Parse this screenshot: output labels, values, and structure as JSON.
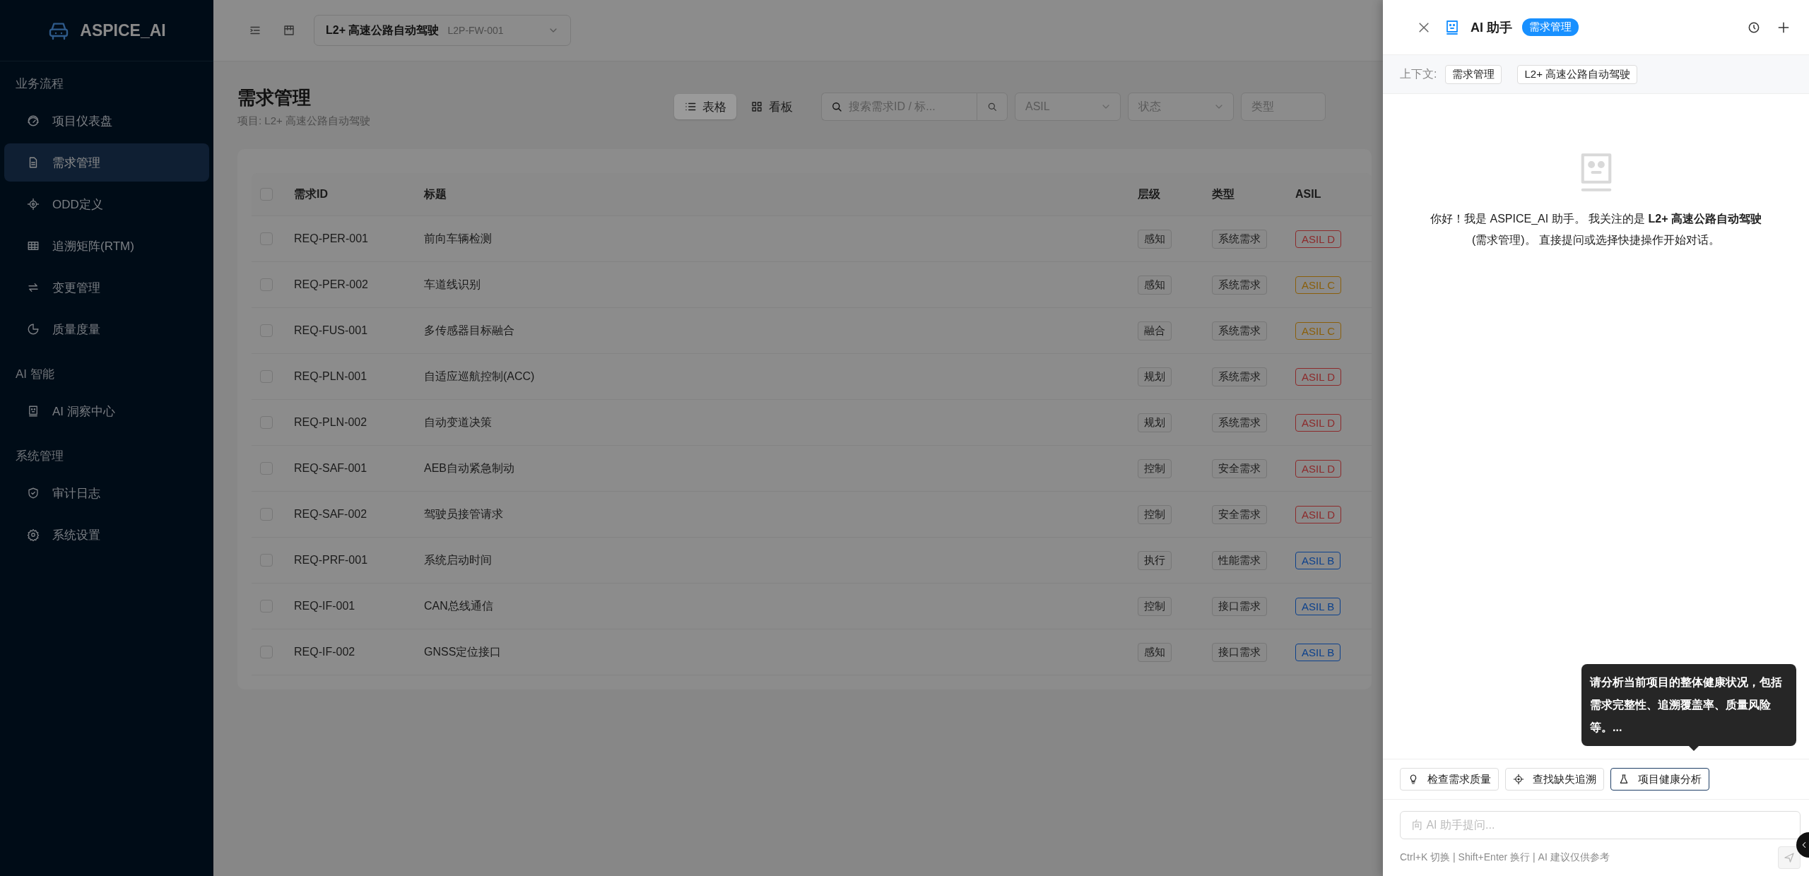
{
  "sidebar": {
    "logo": "ASPICE_AI",
    "sections": [
      {
        "title": "业务流程",
        "items": [
          {
            "label": "项目仪表盘",
            "selected": false
          },
          {
            "label": "需求管理",
            "selected": true
          },
          {
            "label": "ODD定义",
            "selected": false
          },
          {
            "label": "追溯矩阵(RTM)",
            "selected": false
          },
          {
            "label": "变更管理",
            "selected": false
          },
          {
            "label": "质量度量",
            "selected": false
          }
        ]
      },
      {
        "title": "AI 智能",
        "items": [
          {
            "label": "AI 洞察中心",
            "selected": false
          }
        ]
      },
      {
        "title": "系统管理",
        "items": [
          {
            "label": "审计日志",
            "selected": false
          },
          {
            "label": "系统设置",
            "selected": false
          }
        ]
      }
    ]
  },
  "header": {
    "project_select": {
      "name": "L2+ 高速公路自动驾驶",
      "code": "L2P-FW-001"
    }
  },
  "page": {
    "title": "需求管理",
    "subtitle": "项目: L2+ 高速公路自动驾驶"
  },
  "toolbar": {
    "views": [
      {
        "label": "表格",
        "selected": true
      },
      {
        "label": "看板",
        "selected": false
      }
    ],
    "search": {
      "placeholder": "搜索需求ID / 标..."
    },
    "filters": [
      {
        "placeholder": "ASIL"
      },
      {
        "placeholder": "状态"
      },
      {
        "placeholder": "类型"
      }
    ]
  },
  "table": {
    "header_checked": false,
    "columns": [
      "需求ID",
      "标题",
      "层级",
      "类型",
      "ASIL"
    ],
    "rows": [
      {
        "checked": false,
        "id": "REQ-PER-001",
        "title": "前向车辆检测",
        "tier": "感知",
        "type": "系统需求",
        "asil": {
          "label": "ASIL D",
          "color": "#8c2a2b"
        }
      },
      {
        "checked": false,
        "id": "REQ-PER-002",
        "title": "车道线识别",
        "tier": "感知",
        "type": "系统需求",
        "asil": {
          "label": "ASIL C",
          "color": "#8a5f0b"
        }
      },
      {
        "checked": false,
        "id": "REQ-FUS-001",
        "title": "多传感器目标融合",
        "tier": "融合",
        "type": "系统需求",
        "asil": {
          "label": "ASIL C",
          "color": "#8a5f0b"
        }
      },
      {
        "checked": false,
        "id": "REQ-PLN-001",
        "title": "自适应巡航控制(ACC)",
        "tier": "规划",
        "type": "系统需求",
        "asil": {
          "label": "ASIL D",
          "color": "#8c2a2b"
        }
      },
      {
        "checked": false,
        "id": "REQ-PLN-002",
        "title": "自动变道决策",
        "tier": "规划",
        "type": "系统需求",
        "asil": {
          "label": "ASIL D",
          "color": "#8c2a2b"
        }
      },
      {
        "checked": false,
        "id": "REQ-SAF-001",
        "title": "AEB自动紧急制动",
        "tier": "控制",
        "type": "安全需求",
        "asil": {
          "label": "ASIL D",
          "color": "#8c2a2b"
        }
      },
      {
        "checked": false,
        "id": "REQ-SAF-002",
        "title": "驾驶员接管请求",
        "tier": "控制",
        "type": "安全需求",
        "asil": {
          "label": "ASIL D",
          "color": "#8c2a2b"
        }
      },
      {
        "checked": false,
        "id": "REQ-PRF-001",
        "title": "系统启动时间",
        "tier": "执行",
        "type": "性能需求",
        "asil": {
          "label": "ASIL B",
          "color": "#0c418c"
        }
      },
      {
        "checked": false,
        "id": "REQ-IF-001",
        "title": "CAN总线通信",
        "tier": "控制",
        "type": "接口需求",
        "asil": {
          "label": "ASIL B",
          "color": "#0c418c"
        }
      },
      {
        "checked": false,
        "id": "REQ-IF-002",
        "title": "GNSS定位接口",
        "tier": "感知",
        "type": "接口需求",
        "asil": {
          "label": "ASIL B",
          "color": "#0c418c"
        }
      }
    ]
  },
  "assistant": {
    "title": "AI 助手",
    "badge": "需求管理",
    "context_label": "上下文:",
    "context_chips": [
      "需求管理",
      "L2+ 高速公路自动驾驶"
    ],
    "greeting": "你好！我是 ASPICE_AI 助手。 我关注的是 **L2+ 高速公路自动驾驶** (需求管理)。 直接提问或选择快捷操作开始对话。",
    "tooltip": "请分析当前项目的整体健康状况，包括需求完整性、追溯覆盖率、质量风险等。...",
    "quick_actions": [
      {
        "label": "检查需求质量",
        "selected": false
      },
      {
        "label": "查找缺失追溯",
        "selected": false
      },
      {
        "label": "项目健康分析",
        "selected": true
      }
    ],
    "input": {
      "placeholder": "向 AI 助手提问..."
    },
    "hint": "Ctrl+K 切换 | Shift+Enter 换行 | AI 建议仅供参考",
    "send_disabled": true
  }
}
